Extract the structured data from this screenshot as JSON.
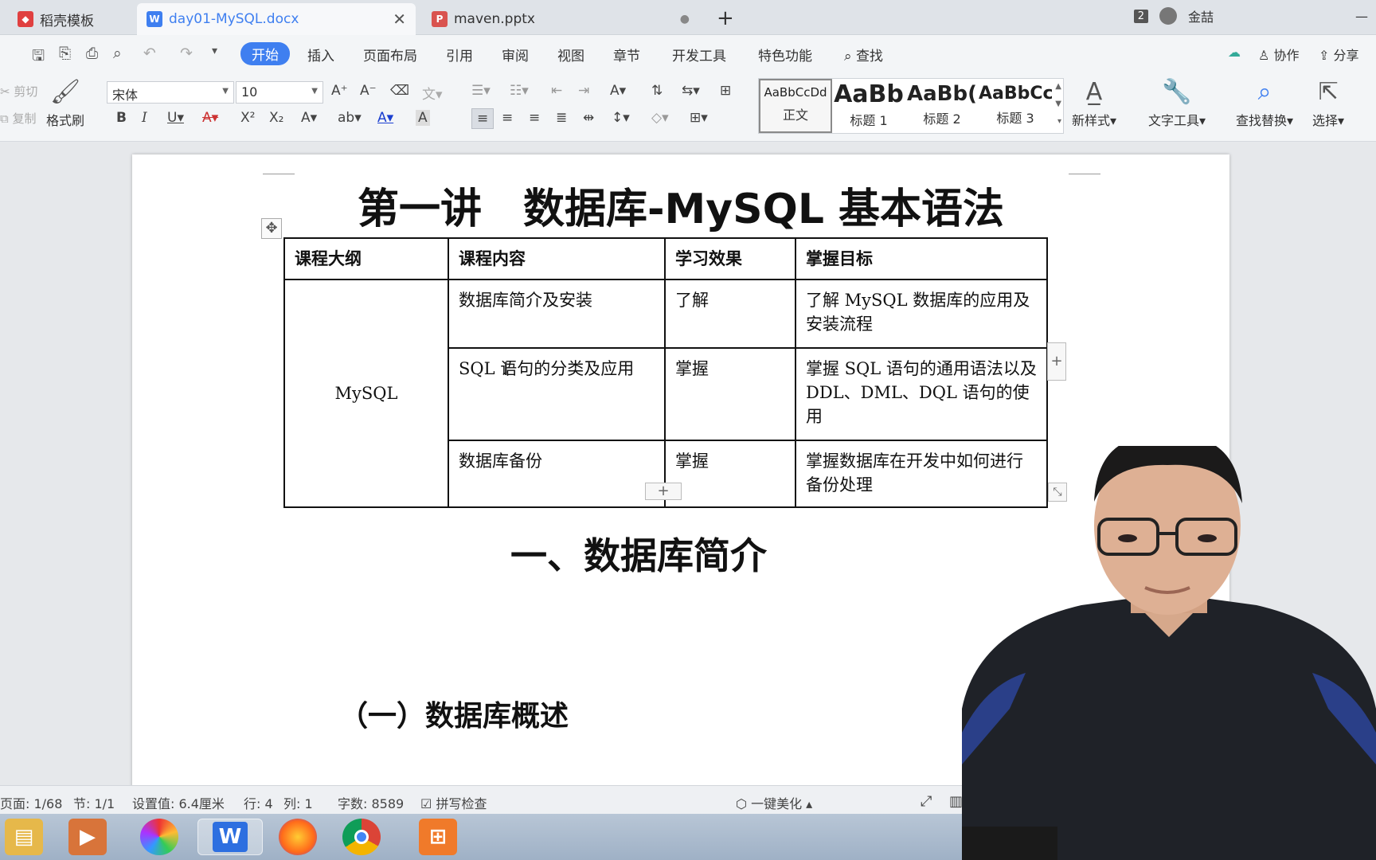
{
  "tabs": [
    {
      "label": "稻壳模板",
      "icon": "docer-icon",
      "color": "#e04040"
    },
    {
      "label": "day01-MySQL.docx",
      "icon": "word-doc-icon",
      "color": "#3f7ff0"
    },
    {
      "label": "maven.pptx",
      "icon": "ppt-icon",
      "color": "#d9534f"
    }
  ],
  "tab_count": "2",
  "user_name": "金喆",
  "menu": {
    "items": [
      "开始",
      "插入",
      "页面布局",
      "引用",
      "审阅",
      "视图",
      "章节",
      "开发工具",
      "特色功能"
    ],
    "search": "查找",
    "collab": "协作",
    "share": "分享"
  },
  "ribbon": {
    "cut": "剪切",
    "copy": "复制",
    "format_painter": "格式刷",
    "font_name": "宋体",
    "font_size": "10",
    "styles": [
      {
        "preview": "AaBbCcDd",
        "label": "正文"
      },
      {
        "preview": "AaBb",
        "label": "标题 1"
      },
      {
        "preview": "AaBb(",
        "label": "标题 2"
      },
      {
        "preview": "AaBbCc",
        "label": "标题 3"
      }
    ],
    "new_style": "新样式",
    "text_tools": "文字工具",
    "find_replace": "查找替换",
    "select": "选择"
  },
  "document": {
    "title": "第一讲　数据库-MySQL 基本语法",
    "table": {
      "headers": [
        "课程大纲",
        "课程内容",
        "学习效果",
        "掌握目标"
      ],
      "group": "MySQL",
      "rows": [
        {
          "content": "数据库简介及安装",
          "effect": "了解",
          "goal": "了解 MySQL 数据库的应用及安装流程"
        },
        {
          "content": "SQL 语句的分类及应用",
          "effect": "掌握",
          "goal": "掌握 SQL 语句的通用语法以及 DDL、DML、DQL 语句的使用"
        },
        {
          "content": "数据库备份",
          "effect": "掌握",
          "goal": "掌握数据库在开发中如何进行备份处理"
        }
      ]
    },
    "section_heading": "一、数据库简介",
    "sub_heading": "（一）数据库概述"
  },
  "status": {
    "page": "页面: 1/68",
    "section": "节: 1/1",
    "setting": "设置值: 6.4厘米",
    "row": "行: 4",
    "col": "列: 1",
    "words": "字数: 8589",
    "spell": "拼写检查",
    "beautify": "一键美化"
  }
}
